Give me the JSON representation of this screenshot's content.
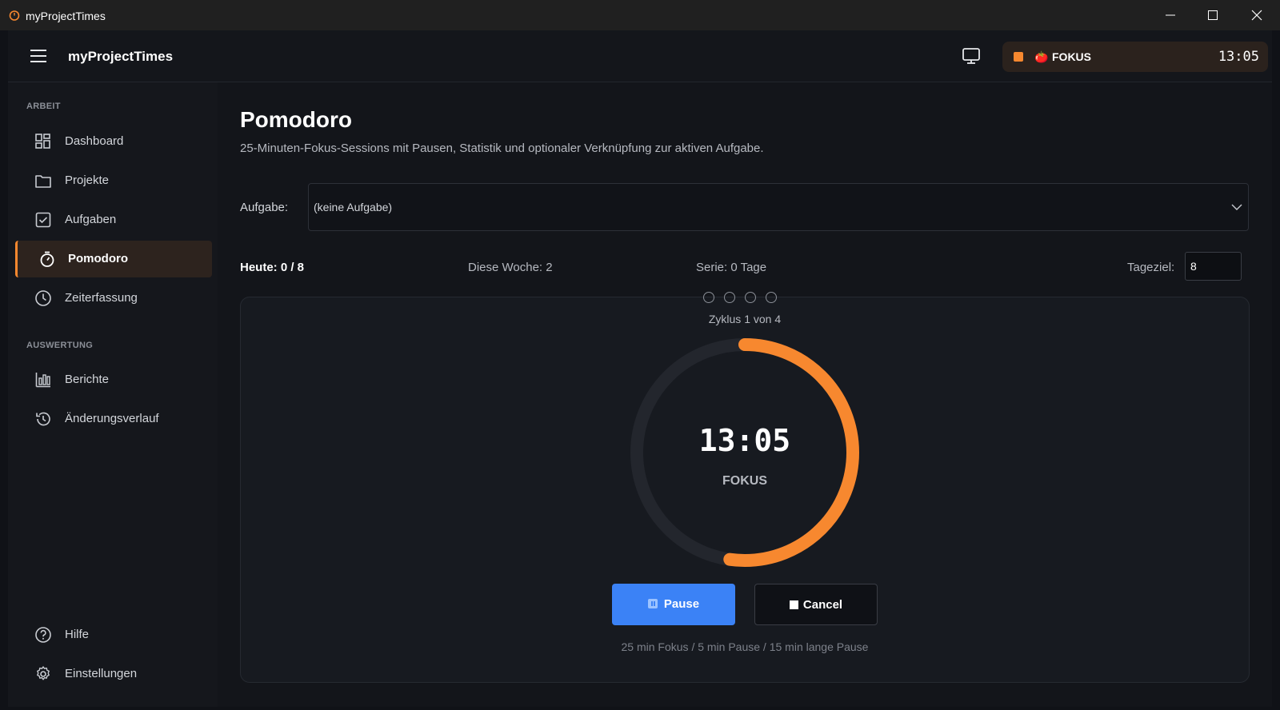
{
  "window": {
    "title": "myProjectTimes"
  },
  "topbar": {
    "app_name": "myProjectTimes",
    "timer_pill": {
      "mode": "FOKUS",
      "time": "13:05",
      "tomato_icon": "🍅"
    }
  },
  "sidebar": {
    "sections": [
      {
        "label": "ARBEIT"
      },
      {
        "label": "AUSWERTUNG"
      }
    ],
    "items": [
      {
        "label": "Dashboard",
        "icon": "dashboard-icon"
      },
      {
        "label": "Projekte",
        "icon": "folder-icon"
      },
      {
        "label": "Aufgaben",
        "icon": "checkbox-icon"
      },
      {
        "label": "Pomodoro",
        "icon": "stopwatch-icon",
        "active": true
      },
      {
        "label": "Zeiterfassung",
        "icon": "clock-icon"
      },
      {
        "label": "Berichte",
        "icon": "bar-chart-icon"
      },
      {
        "label": "Änderungsverlauf",
        "icon": "history-icon"
      },
      {
        "label": "Hilfe",
        "icon": "help-icon"
      },
      {
        "label": "Einstellungen",
        "icon": "gear-icon"
      }
    ]
  },
  "main": {
    "title": "Pomodoro",
    "subtitle": "25-Minuten-Fokus-Sessions mit Pausen, Statistik und optionaler Verknüpfung zur aktiven Aufgabe.",
    "task": {
      "label": "Aufgabe:",
      "value": "(keine Aufgabe)"
    },
    "stats": {
      "today": "Heute: 0 / 8",
      "week": "Diese Woche: 2",
      "streak": "Serie: 0 Tage",
      "goal_label": "Tageziel:",
      "goal_value": "8"
    },
    "timer": {
      "cycle_text": "Zyklus 1 von 4",
      "cycles_completed": 0,
      "cycles_total": 4,
      "time": "13:05",
      "mode": "FOKUS",
      "progress_remaining": 0.522
    },
    "buttons": {
      "pause": "Pause",
      "cancel": "Cancel"
    },
    "durations": "25 min Fokus  /  5 min Pause  /  15 min lange Pause"
  },
  "colors": {
    "accent": "#f7882f",
    "primary_button": "#3b82f6",
    "ring_track": "#23262d"
  }
}
